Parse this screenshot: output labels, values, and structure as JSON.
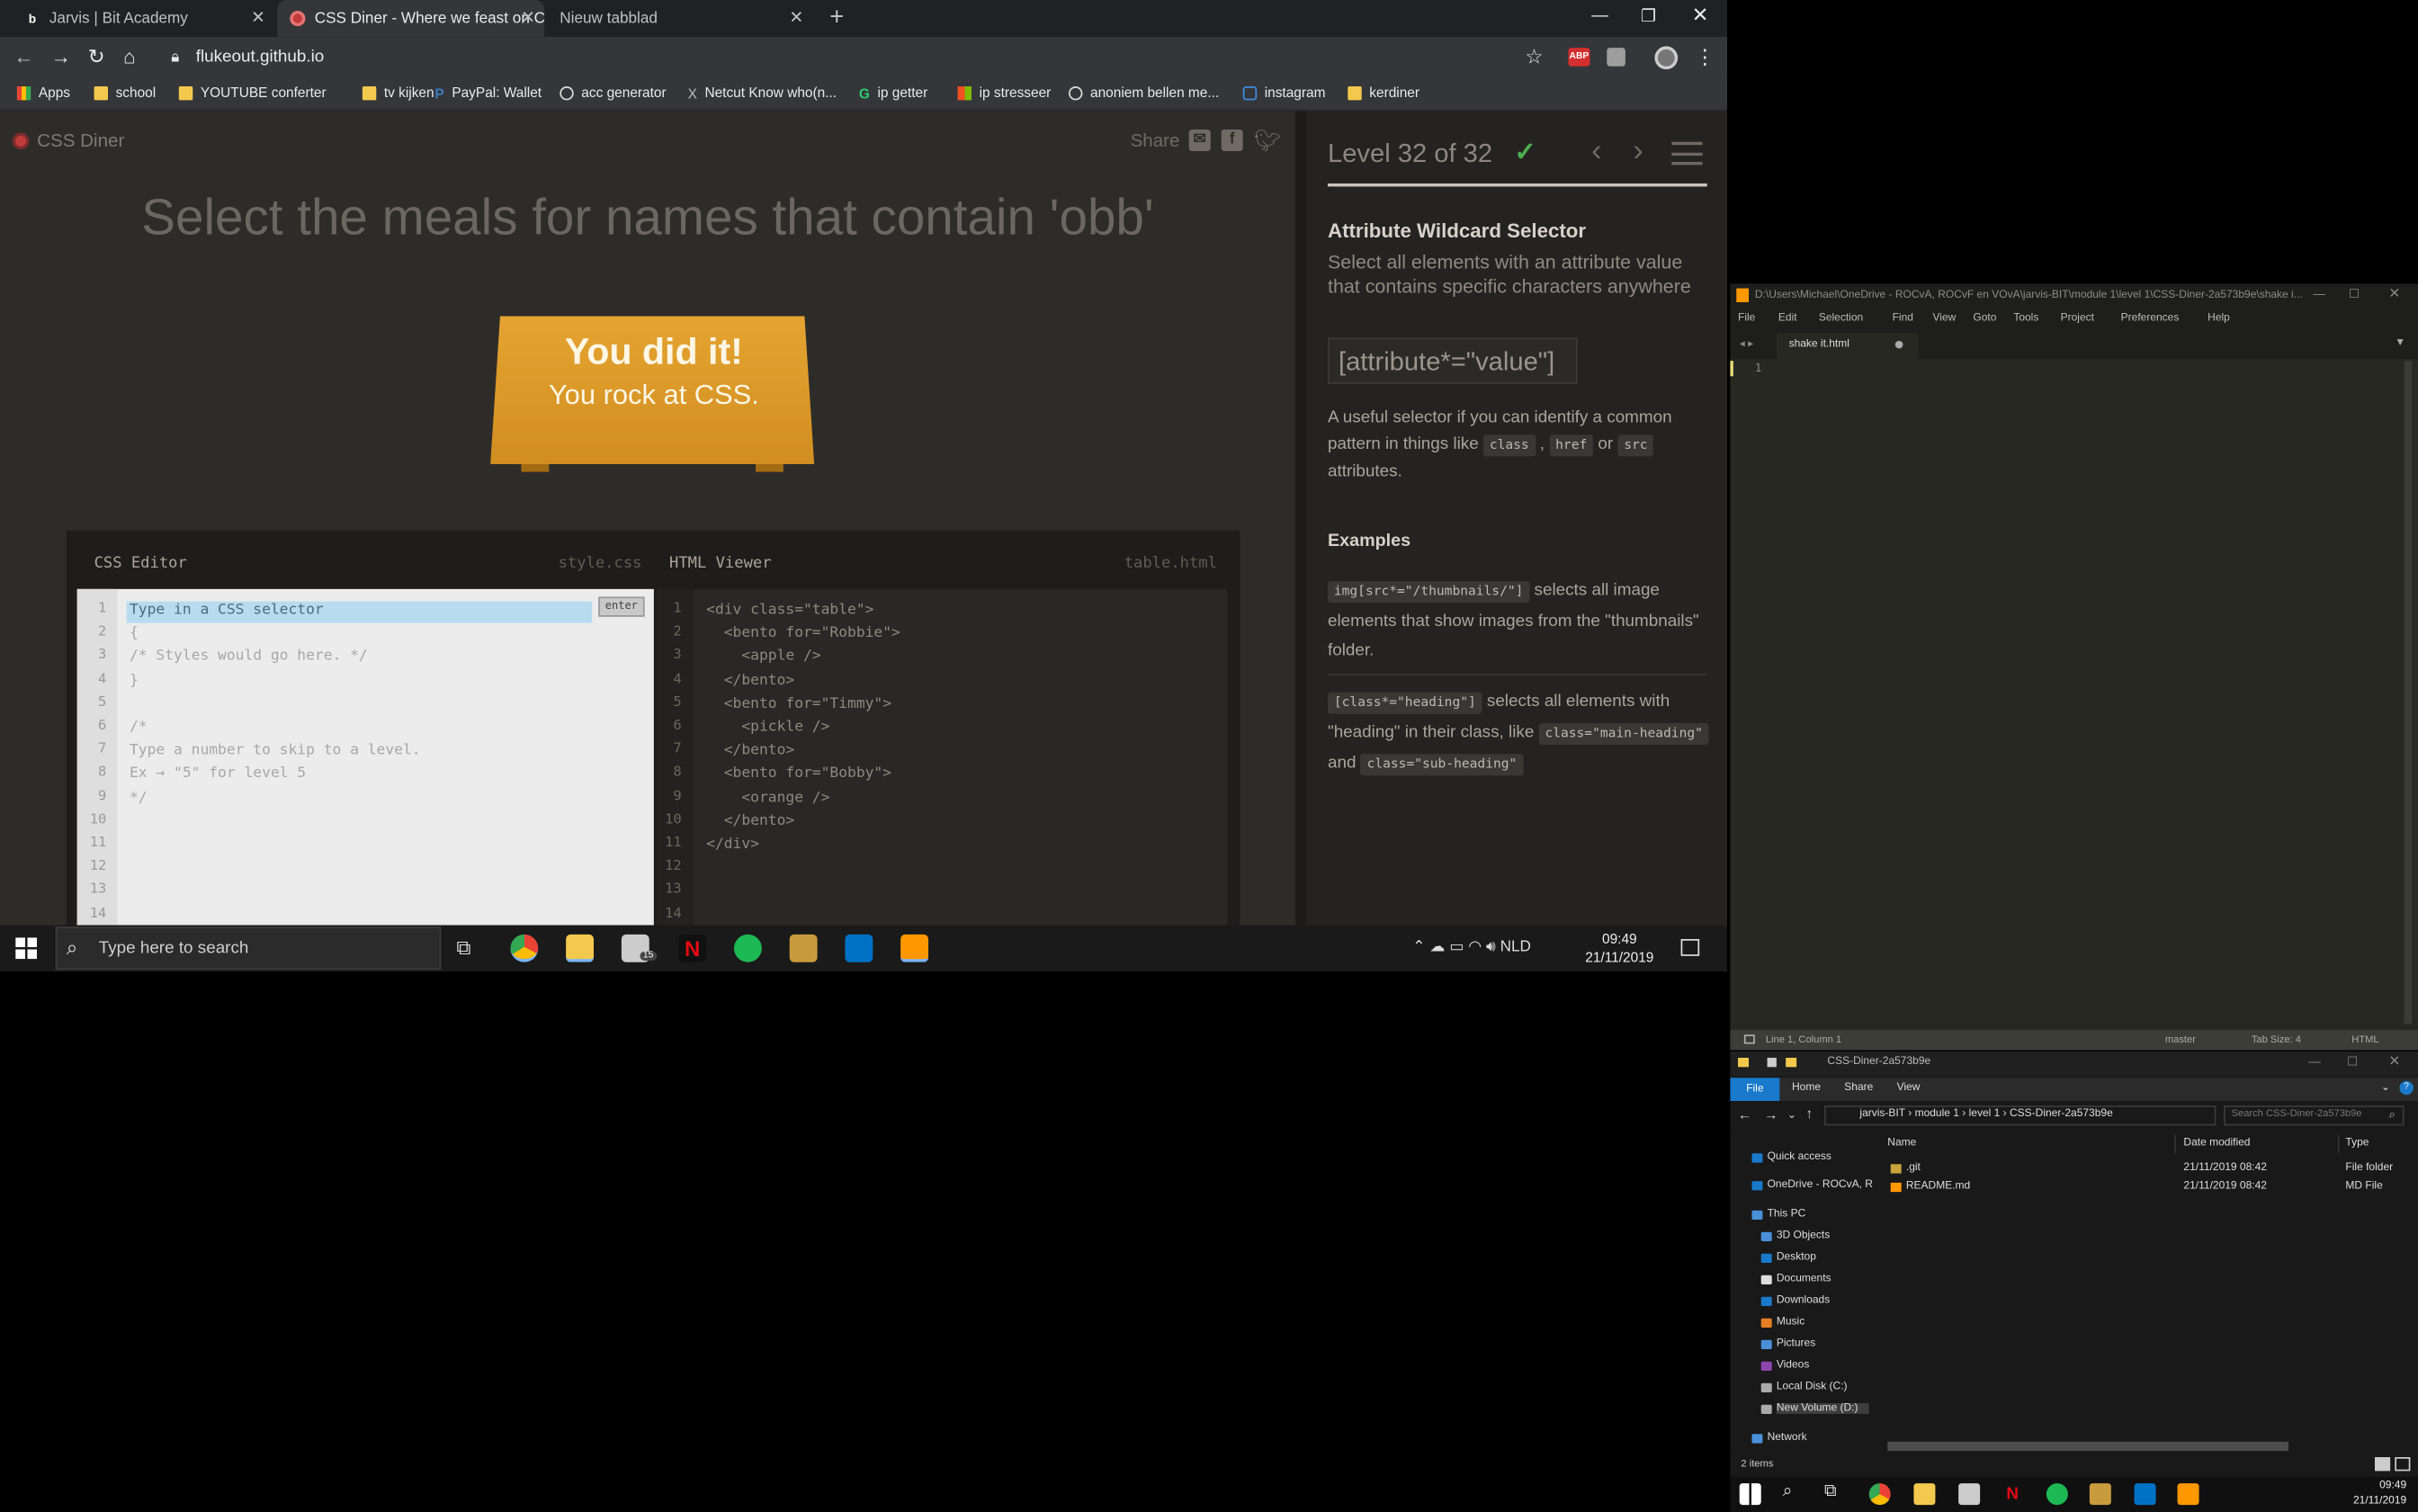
{
  "browser": {
    "tabs": [
      {
        "label": "Jarvis | Bit Academy",
        "icon": "b"
      },
      {
        "label": "CSS Diner - Where we feast on C",
        "icon": "css-diner-logo"
      },
      {
        "label": "Nieuw tabblad",
        "icon": ""
      }
    ],
    "url": "flukeout.github.io",
    "bookmarks": [
      "Apps",
      "school",
      "YOUTUBE conferter",
      "tv kijken",
      "PayPal: Wallet",
      "acc generator",
      "Netcut Know who(n...",
      "ip getter",
      "ip stresseer",
      "anoniem bellen me...",
      "instagram",
      "kerdiner"
    ],
    "ext_abp": "ABP"
  },
  "diner": {
    "logo": "CSS Diner",
    "share": "Share",
    "instruction": "Select the meals for names that contain 'obb'",
    "plate_line1": "You did it!",
    "plate_line2": "You rock at CSS.",
    "css_editor_title": "CSS Editor",
    "css_editor_file": "style.css",
    "html_viewer_title": "HTML Viewer",
    "html_viewer_file": "table.html",
    "enter_label": "enter",
    "css_lines": [
      "Type in a CSS selector",
      "{",
      "/* Styles would go here. */",
      "}",
      "",
      "/*",
      "Type a number to skip to a level.",
      "Ex → \"5\" for level 5",
      "*/",
      "",
      "",
      "",
      "",
      ""
    ],
    "html_lines": [
      "<div class=\"table\">",
      "  <bento for=\"Robbie\">",
      "    <apple />",
      "  </bento>",
      "  <bento for=\"Timmy\">",
      "    <pickle />",
      "  </bento>",
      "  <bento for=\"Bobby\">",
      "    <orange />",
      "  </bento>",
      "</div>",
      "",
      "",
      ""
    ]
  },
  "sidebar": {
    "level": "Level 32 of 32",
    "selector_name": "Attribute Wildcard Selector",
    "description": "Select all elements with an attribute value that contains specific characters anywhere",
    "syntax": "[attribute*=\"value\"]",
    "para_a": "A useful selector if you can identify a common pattern in things like",
    "chip_class": "class",
    "chip_href": "href",
    "chip_src": "src",
    "para_or": "or",
    "para_end": "attributes.",
    "examples_title": "Examples",
    "ex1_code": "img[src*=\"/thumbnails/\"]",
    "ex1_text": "selects all image elements that show images from the \"thumbnails\" folder.",
    "ex2_code": "[class*=\"heading\"]",
    "ex2_text_a": "selects all elements with \"heading\" in their class, like",
    "ex2_chip1": "class=\"main-heading\"",
    "ex2_and": "and",
    "ex2_chip2": "class=\"sub-heading\""
  },
  "taskbar": {
    "search_placeholder": "Type here to search",
    "lang": "NLD",
    "time": "09:49",
    "date": "21/11/2019",
    "mail_badge": "15"
  },
  "sublime": {
    "title": "D:\\Users\\Michael\\OneDrive - ROCvA, ROCvF en VOvA\\jarvis-BIT\\module 1\\level 1\\CSS-Diner-2a573b9e\\shake i...",
    "menu": [
      "File",
      "Edit",
      "Selection",
      "Find",
      "View",
      "Goto",
      "Tools",
      "Project",
      "Preferences",
      "Help"
    ],
    "tab": "shake it.html",
    "line1": "1",
    "status_pos": "Line 1, Column 1",
    "status_branch": "master",
    "status_tab": "Tab Size: 4",
    "status_syntax": "HTML"
  },
  "explorer": {
    "title": "CSS-Diner-2a573b9e",
    "ribbon": [
      "File",
      "Home",
      "Share",
      "View"
    ],
    "path": [
      "jarvis-BIT",
      "module 1",
      "level 1",
      "CSS-Diner-2a573b9e"
    ],
    "search_placeholder": "Search CSS-Diner-2a573b9e",
    "nav": [
      "Quick access",
      "OneDrive - ROCvA, R",
      "This PC",
      "3D Objects",
      "Desktop",
      "Documents",
      "Downloads",
      "Music",
      "Pictures",
      "Videos",
      "Local Disk (C:)",
      "New Volume (D:)",
      "Network"
    ],
    "columns": [
      "Name",
      "Date modified",
      "Type"
    ],
    "files": [
      {
        "name": ".git",
        "date": "21/11/2019 08:42",
        "type": "File folder"
      },
      {
        "name": "README.md",
        "date": "21/11/2019 08:42",
        "type": "MD File"
      }
    ],
    "status": "2 items"
  },
  "taskbar2": {
    "time": "09:49",
    "date": "21/11/2019"
  }
}
